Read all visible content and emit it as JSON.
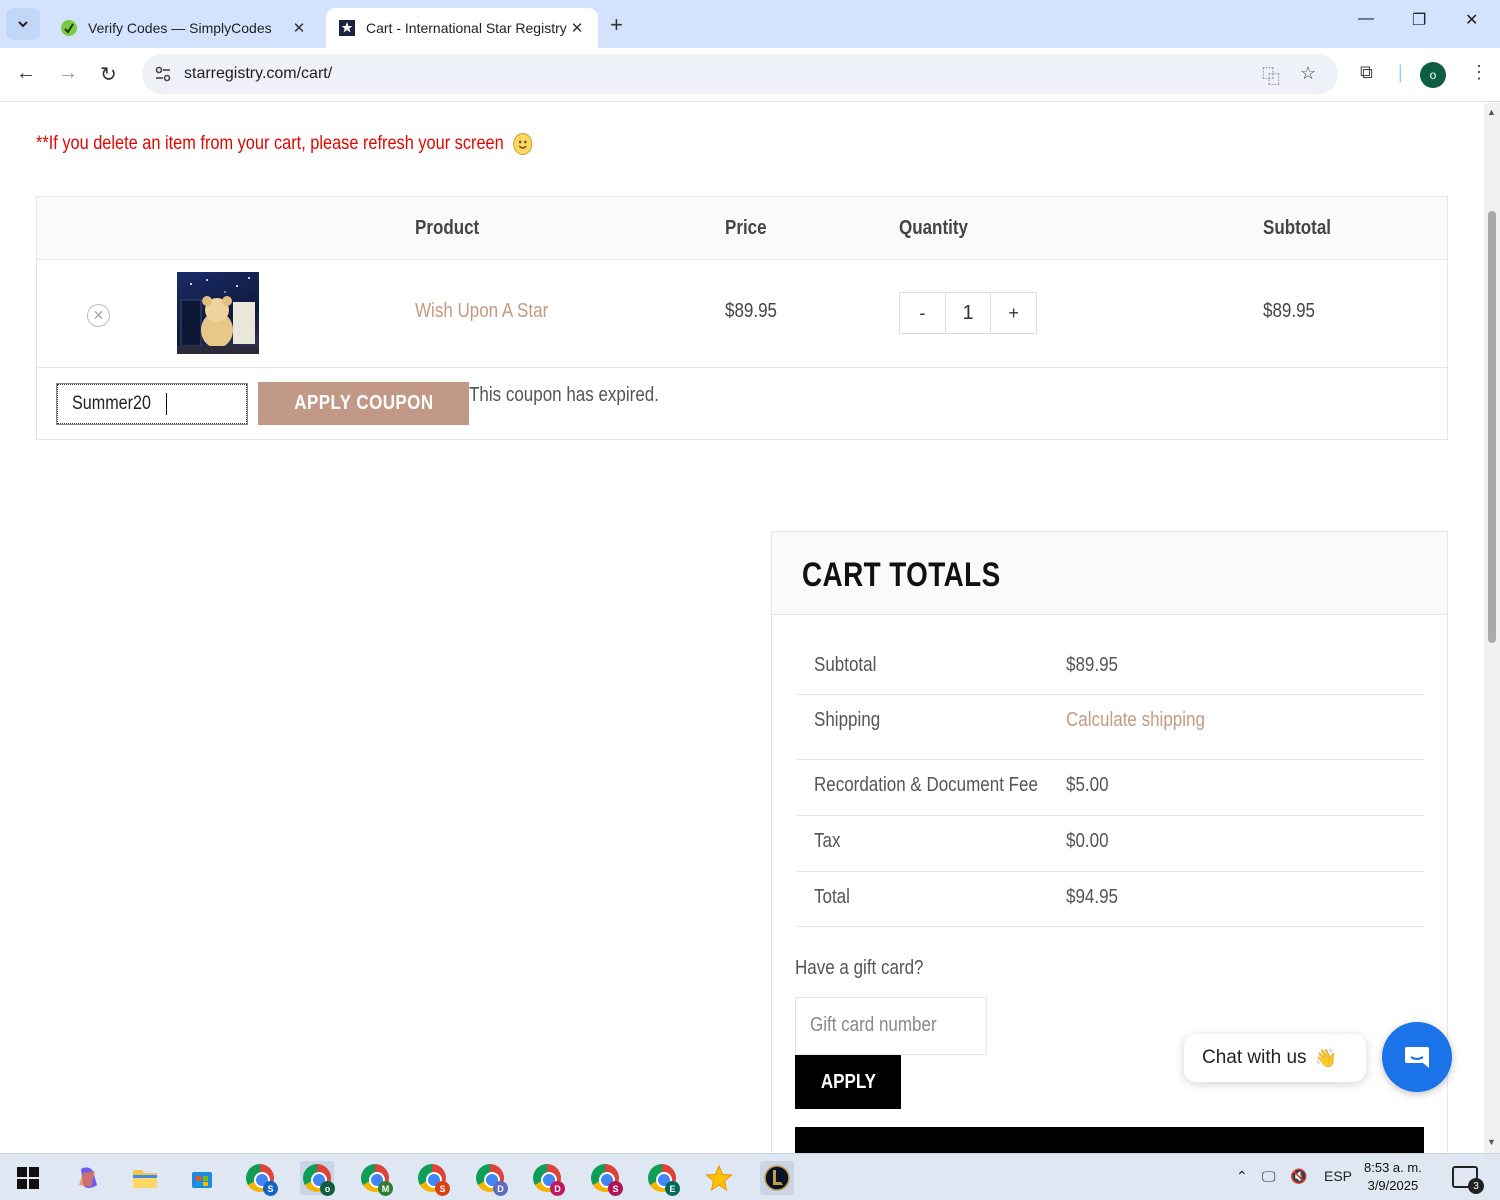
{
  "browser": {
    "tabs": [
      {
        "title": "Verify Codes — SimplyCodes",
        "active": false,
        "icon": "simplycodes-icon"
      },
      {
        "title": "Cart - International Star Registry",
        "active": true,
        "icon": "star-registry-icon"
      }
    ],
    "url": "starregistry.com/cart/",
    "profile_initial": "o"
  },
  "page": {
    "notice": "**If you delete an item from your cart, please refresh your screen",
    "table": {
      "headers": {
        "product": "Product",
        "price": "Price",
        "quantity": "Quantity",
        "subtotal": "Subtotal"
      },
      "items": [
        {
          "name": "Wish Upon A Star",
          "price": "$89.95",
          "quantity": "1",
          "subtotal": "$89.95"
        }
      ],
      "qty_minus": "-",
      "qty_plus": "+"
    },
    "coupon": {
      "value": "Summer20",
      "button": "APPLY COUPON",
      "message": "This coupon has expired."
    },
    "totals": {
      "title": "CART TOTALS",
      "rows": [
        {
          "label": "Subtotal",
          "value": "$89.95"
        },
        {
          "label": "Shipping",
          "value": "Calculate shipping"
        },
        {
          "label": "Recordation & Document Fee",
          "value": "$5.00"
        },
        {
          "label": "Tax",
          "value": "$0.00"
        },
        {
          "label": "Total",
          "value": "$94.95"
        }
      ],
      "gift_question": "Have a gift card?",
      "gift_placeholder": "Gift card number",
      "gift_button": "APPLY"
    },
    "chat": {
      "label": "Chat with us",
      "emoji": "👋"
    }
  },
  "taskbar": {
    "apps": [
      {
        "name": "copilot"
      },
      {
        "name": "file-explorer"
      },
      {
        "name": "microsoft-store"
      },
      {
        "name": "chrome",
        "badge": "S"
      },
      {
        "name": "chrome",
        "badge": "o"
      },
      {
        "name": "chrome",
        "badge": "M"
      },
      {
        "name": "chrome",
        "badge": "S"
      },
      {
        "name": "chrome",
        "badge": "D"
      },
      {
        "name": "chrome",
        "badge": "D"
      },
      {
        "name": "chrome",
        "badge": "S"
      },
      {
        "name": "chrome",
        "badge": "E"
      },
      {
        "name": "star-app"
      },
      {
        "name": "league-of-legends"
      }
    ],
    "language": "ESP",
    "time": "8:53 a. m.",
    "date": "3/9/2025",
    "notifications": "3"
  }
}
